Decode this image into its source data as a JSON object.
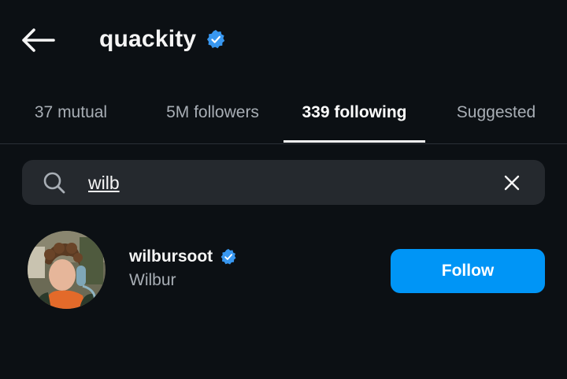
{
  "header": {
    "title": "quackity",
    "back_icon": "arrow-left-icon",
    "verified_icon": "verified-badge-icon"
  },
  "tabs": [
    {
      "label": "37 mutual",
      "active": false
    },
    {
      "label": "5M followers",
      "active": false
    },
    {
      "label": "339 following",
      "active": true
    },
    {
      "label": "Suggested",
      "active": false
    }
  ],
  "search": {
    "value": "wilb",
    "search_icon": "search-icon",
    "clear_icon": "close-icon"
  },
  "results": [
    {
      "username": "wilbursoot",
      "display_name": "Wilbur",
      "verified": true,
      "follow_label": "Follow"
    }
  ],
  "colors": {
    "background": "#0c1014",
    "accent_blue": "#0095f6",
    "verified_blue": "#3897f0",
    "search_bg": "#25292e",
    "muted_text": "#a8aeb5"
  }
}
